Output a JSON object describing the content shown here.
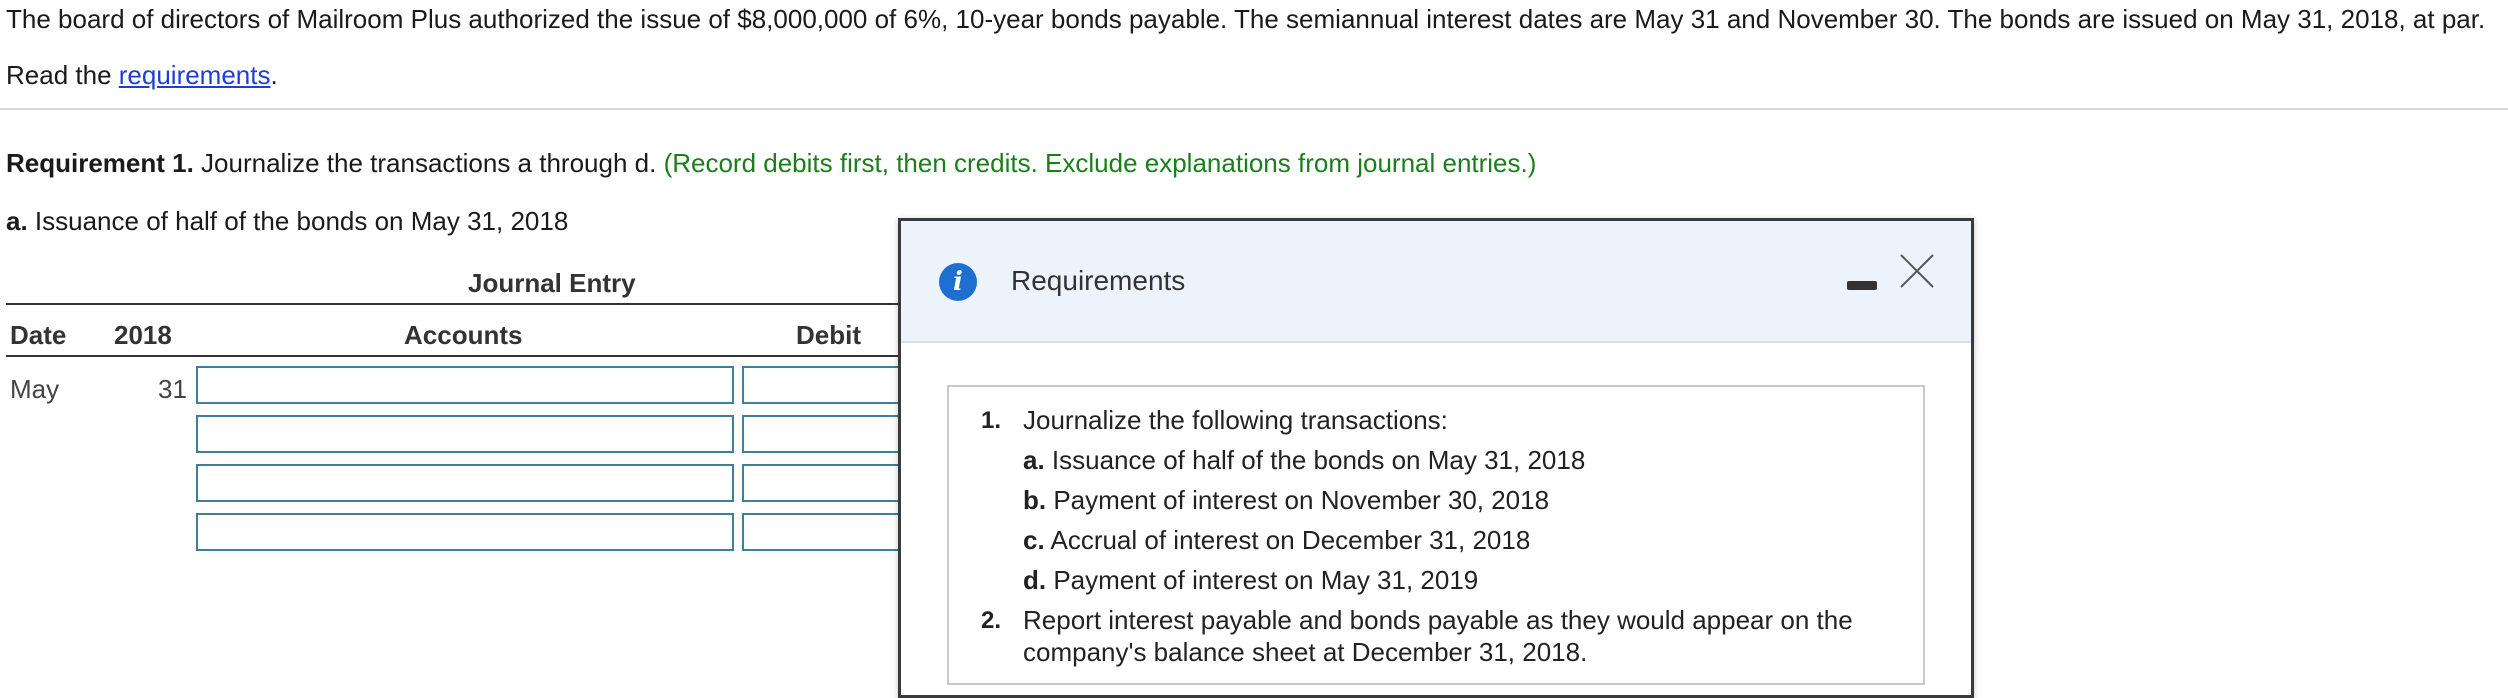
{
  "problem": {
    "text": "The board of directors of Mailroom Plus authorized the issue of $8,000,000 of 6%, 10-year bonds payable. The semiannual interest dates are May 31 and November 30. The bonds are issued on May 31, 2018, at par.",
    "read_prefix": "Read the ",
    "requirements_link": "requirements",
    "read_suffix": "."
  },
  "requirement1": {
    "label": "Requirement 1.",
    "text": " Journalize the transactions a through d. ",
    "hint": "(Record debits first, then credits. Exclude explanations from journal entries.)"
  },
  "part_a": {
    "label": "a.",
    "text": " Issuance of half of the bonds on May 31, 2018"
  },
  "journal": {
    "title": "Journal Entry",
    "headers": {
      "date": "Date",
      "year": "2018",
      "accounts": "Accounts",
      "debit": "Debit"
    },
    "first_row": {
      "month": "May",
      "day": "31"
    }
  },
  "modal": {
    "title": "Requirements",
    "items": [
      {
        "num": "1.",
        "text": "Journalize the following transactions:"
      },
      {
        "label": "a.",
        "text": " Issuance of half of the bonds on May 31, 2018"
      },
      {
        "label": "b.",
        "text": " Payment of interest on November 30, 2018"
      },
      {
        "label": "c.",
        "text": " Accrual of interest on December 31, 2018"
      },
      {
        "label": "d.",
        "text": " Payment of interest on May 31, 2019"
      },
      {
        "num": "2.",
        "line1": "Report interest payable and bonds payable as they would appear on the",
        "line2": "company's balance sheet at December 31, 2018."
      }
    ]
  }
}
